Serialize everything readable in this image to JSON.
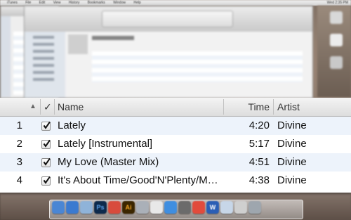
{
  "colors": {
    "header_bg": "#e6e6e6",
    "row_alt": "#edf3fb",
    "row_bg": "#ffffff",
    "text": "#111111"
  },
  "background": {
    "menubar_items": [
      "iTunes",
      "File",
      "Edit",
      "View",
      "History",
      "Bookmarks",
      "Window",
      "Help"
    ],
    "clock": "Wed 2:35 PM",
    "dock_icons": [
      "finder-icon",
      "app-store-icon",
      "safari-icon",
      "photoshop-icon",
      "chrome-icon",
      "illustrator-icon",
      "launchpad-icon",
      "app-icon",
      "preview-icon",
      "chrome-icon-2",
      "word-icon",
      "folder-icon",
      "trash-icon"
    ]
  },
  "table": {
    "header": {
      "sort_indicator": "▲",
      "check_header": "✓",
      "name": "Name",
      "time": "Time",
      "artist": "Artist"
    },
    "rows": [
      {
        "num": "1",
        "name": "Lately",
        "time": "4:20",
        "artist": "Divine",
        "checked": true
      },
      {
        "num": "2",
        "name": "Lately [Instrumental]",
        "time": "5:17",
        "artist": "Divine",
        "checked": true
      },
      {
        "num": "3",
        "name": "My Love (Master Mix)",
        "time": "4:51",
        "artist": "Divine",
        "checked": true
      },
      {
        "num": "4",
        "name": "It's About Time/Good'N'Plenty/M…",
        "time": "4:38",
        "artist": "Divine",
        "checked": true
      }
    ]
  }
}
